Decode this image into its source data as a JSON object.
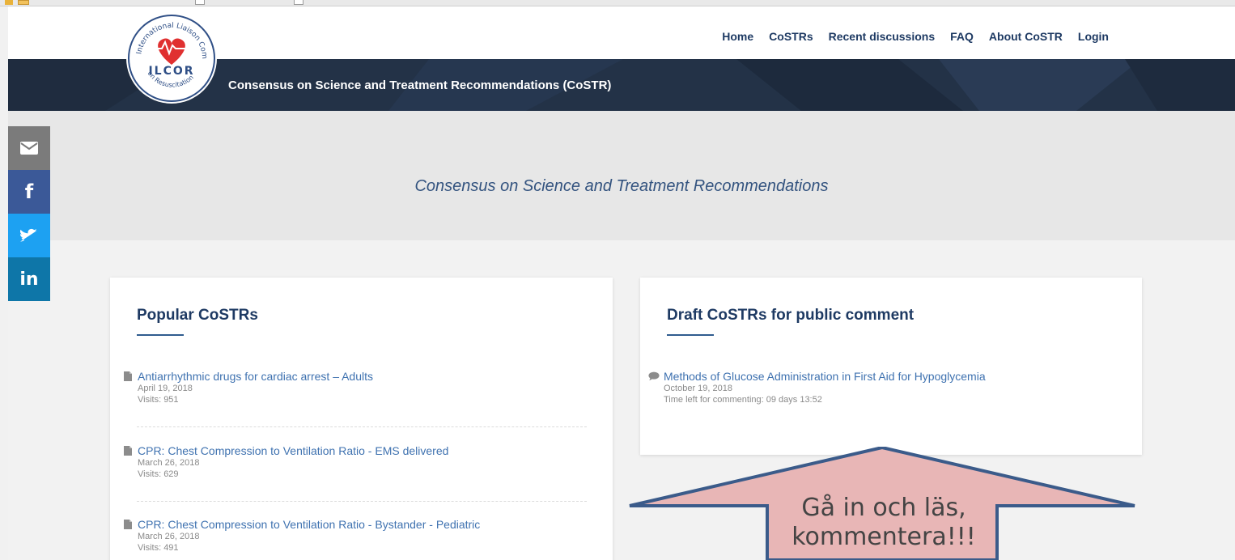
{
  "nav": {
    "items": [
      "Home",
      "CoSTRs",
      "Recent discussions",
      "FAQ",
      "About CoSTR",
      "Login"
    ]
  },
  "banner": {
    "title": "Consensus on Science and Treatment Recommendations (CoSTR)"
  },
  "logo": {
    "text_top": "International Liaison Committee",
    "text_mid": "ILCOR",
    "text_bottom": "on Resuscitation"
  },
  "hero": {
    "subtitle": "Consensus on Science and Treatment Recommendations"
  },
  "social": {
    "items": [
      "email-icon",
      "facebook-icon",
      "twitter-icon",
      "linkedin-icon"
    ],
    "fb_glyph": "f",
    "in_glyph": "in"
  },
  "popular": {
    "title": "Popular CoSTRs",
    "items": [
      {
        "title": "Antiarrhythmic drugs for cardiac arrest – Adults",
        "date": "April 19, 2018",
        "visits": "Visits: 951"
      },
      {
        "title": "CPR: Chest Compression to Ventilation Ratio - EMS delivered",
        "date": "March 26, 2018",
        "visits": "Visits: 629"
      },
      {
        "title": "CPR: Chest Compression to Ventilation Ratio - Bystander - Pediatric",
        "date": "March 26, 2018",
        "visits": "Visits: 491"
      }
    ]
  },
  "drafts": {
    "title": "Draft CoSTRs for public comment",
    "items": [
      {
        "title": "Methods of Glucose Administration in First Aid for Hypoglycemia",
        "date": "October 19, 2018",
        "time_left": "Time left for commenting: 09 days 13:52"
      }
    ]
  },
  "callout": {
    "line1": "Gå in och läs,",
    "line2": "kommentera!!!"
  },
  "colors": {
    "nav_text": "#1e3a63",
    "banner_bg": "#233247",
    "link": "#3f72b0",
    "callout_fill": "#e8b6b6",
    "callout_stroke": "#3b5b8a"
  }
}
